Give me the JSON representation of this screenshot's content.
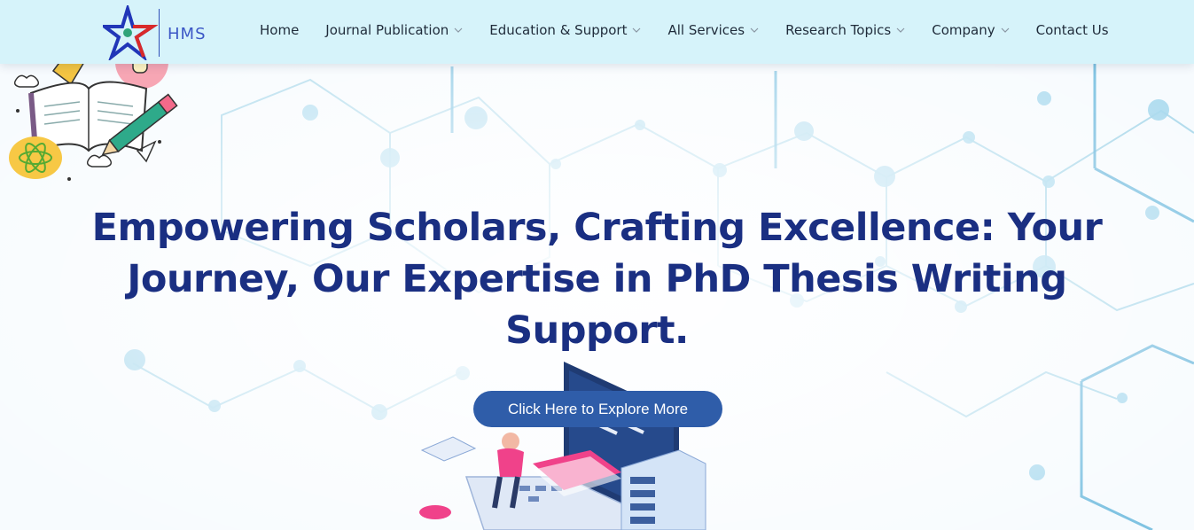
{
  "brand": {
    "name": "HMS",
    "logo_icon": "star-logo-icon"
  },
  "nav": {
    "items": [
      {
        "label": "Home",
        "has_dropdown": false
      },
      {
        "label": "Journal Publication",
        "has_dropdown": true
      },
      {
        "label": "Education & Support",
        "has_dropdown": true
      },
      {
        "label": "All Services",
        "has_dropdown": true
      },
      {
        "label": "Research Topics",
        "has_dropdown": true
      },
      {
        "label": "Company",
        "has_dropdown": true
      },
      {
        "label": "Contact Us",
        "has_dropdown": false
      }
    ]
  },
  "hero": {
    "title_lines": [
      "Empowering Scholars, Crafting Excellence: Your",
      "Journey, Our Expertise in PhD Thesis Writing",
      "Support."
    ],
    "cta_label": "Click Here to Explore More"
  },
  "colors": {
    "navbar_bg": "#d6f3fa",
    "title": "#1a2f82",
    "cta_bg": "#2f5da9",
    "network_lines": "#8fcbe3"
  }
}
